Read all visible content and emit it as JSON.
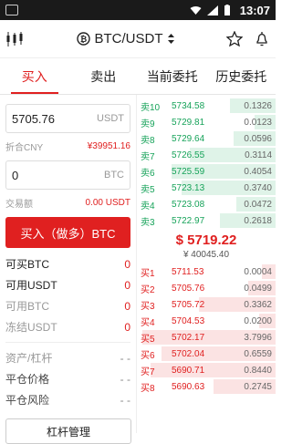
{
  "status": {
    "time": "13:07"
  },
  "header": {
    "pair": "BTC/USDT"
  },
  "tabs": [
    "买入",
    "卖出",
    "当前委托",
    "历史委托"
  ],
  "form": {
    "price_value": "5705.76",
    "price_unit": "USDT",
    "cny_label": "折合CNY",
    "cny_value": "¥39951.16",
    "amount_value": "0",
    "amount_unit": "BTC",
    "volume_label": "交易额",
    "volume_value": "0.00 USDT",
    "buy_label": "买入（做多）BTC"
  },
  "balances": [
    {
      "label": "可买BTC",
      "value": "0"
    },
    {
      "label": "可用USDT",
      "value": "0"
    },
    {
      "label": "可用BTC",
      "value": "0"
    },
    {
      "label": "冻结USDT",
      "value": "0"
    }
  ],
  "risk": [
    {
      "label": "资产/杠杆",
      "value": "- -"
    },
    {
      "label": "平仓价格",
      "value": "- -"
    },
    {
      "label": "平仓风险",
      "value": "- -"
    }
  ],
  "manage_label": "杠杆管理",
  "orderbook": {
    "asks": [
      {
        "label": "卖10",
        "price": "5734.58",
        "qty": "0.1326",
        "depth": 0.33
      },
      {
        "label": "卖9",
        "price": "5729.81",
        "qty": "0.0123",
        "depth": 0.15
      },
      {
        "label": "卖8",
        "price": "5729.64",
        "qty": "0.0596",
        "depth": 0.3
      },
      {
        "label": "卖7",
        "price": "5726.55",
        "qty": "0.3114",
        "depth": 0.62
      },
      {
        "label": "卖6",
        "price": "5725.59",
        "qty": "0.4054",
        "depth": 0.75
      },
      {
        "label": "卖5",
        "price": "5723.13",
        "qty": "0.3740",
        "depth": 0.68
      },
      {
        "label": "卖4",
        "price": "5723.08",
        "qty": "0.0472",
        "depth": 0.28
      },
      {
        "label": "卖3",
        "price": "5722.97",
        "qty": "0.2618",
        "depth": 0.4
      }
    ],
    "last_price": "$ 5719.22",
    "last_cny": "¥ 40045.40",
    "bids": [
      {
        "label": "买1",
        "price": "5711.53",
        "qty": "0.0004",
        "depth": 0.1
      },
      {
        "label": "买2",
        "price": "5705.76",
        "qty": "0.0499",
        "depth": 0.2
      },
      {
        "label": "买3",
        "price": "5705.72",
        "qty": "0.3362",
        "depth": 0.55
      },
      {
        "label": "买4",
        "price": "5704.53",
        "qty": "0.0200",
        "depth": 0.12
      },
      {
        "label": "买5",
        "price": "5702.17",
        "qty": "3.7996",
        "depth": 0.96
      },
      {
        "label": "买6",
        "price": "5702.04",
        "qty": "0.6559",
        "depth": 0.82
      },
      {
        "label": "买7",
        "price": "5690.71",
        "qty": "0.8440",
        "depth": 0.9
      },
      {
        "label": "买8",
        "price": "5690.63",
        "qty": "0.2745",
        "depth": 0.45
      }
    ]
  }
}
